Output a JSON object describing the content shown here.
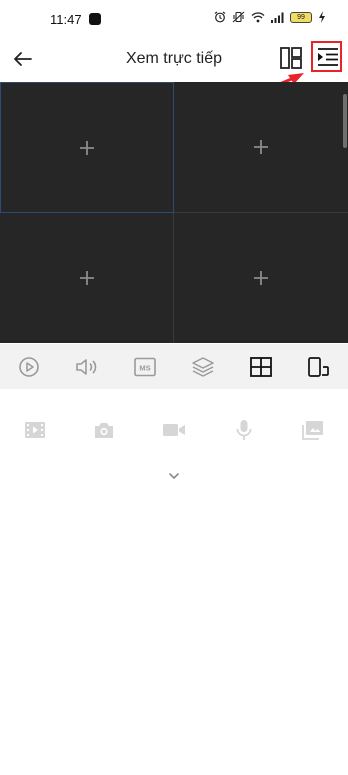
{
  "status_bar": {
    "time": "11:47",
    "battery": "99"
  },
  "header": {
    "title": "Xem trực tiếp"
  },
  "colors": {
    "video_bg": "#262626",
    "control_bar_bg": "#f2f2f2",
    "highlight_red": "#e8232a",
    "selected_border": "#2b4b7a"
  },
  "controls": {
    "icons": [
      "play-icon",
      "speaker-icon",
      "ms-stream-icon",
      "layers-icon",
      "grid-layout-icon",
      "device-orientation-icon"
    ],
    "ms_label": "MS"
  },
  "tools": {
    "icons": [
      "video-clip-icon",
      "camera-icon",
      "record-icon",
      "microphone-icon",
      "gallery-icon"
    ]
  }
}
